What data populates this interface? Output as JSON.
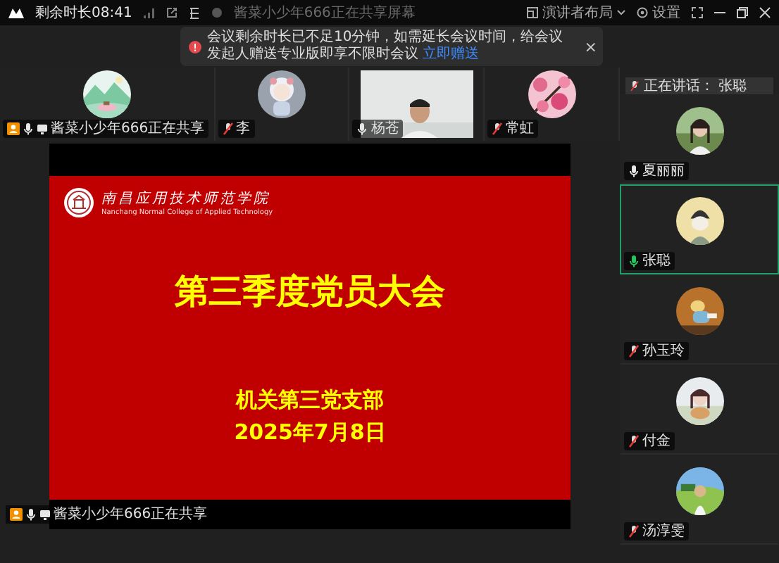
{
  "top_bar": {
    "remaining_time": "剩余时长08:41",
    "sharing_notice": "酱菜小少年666正在共享屏幕",
    "buttons": [
      {
        "kind": "layout",
        "label": "演讲者布局"
      },
      {
        "kind": "settings",
        "label": "设置"
      }
    ]
  },
  "notification": {
    "message": "会议剩余时长已不足10分钟，如需延长会议时间，给会议发起人赠送专业版即享不限时会议",
    "link": "立即赠送",
    "close": "×"
  },
  "top_strip": [
    {
      "name": "酱菜小少年666正在共享",
      "muted": false,
      "host": true,
      "sharing": true,
      "kind": "avatar"
    },
    {
      "name": "李",
      "muted": true,
      "host": false,
      "sharing": false,
      "kind": "avatar"
    },
    {
      "name": "杨苍",
      "muted": false,
      "host": false,
      "sharing": false,
      "kind": "video"
    },
    {
      "name": "常虹",
      "muted": true,
      "host": false,
      "sharing": false,
      "kind": "avatar"
    }
  ],
  "speaking": {
    "label": "正在讲话：",
    "name": "张聪"
  },
  "side_list": [
    {
      "name": "夏丽丽",
      "muted": false,
      "speaking": false,
      "selected": false
    },
    {
      "name": "张聪",
      "muted": false,
      "speaking": true,
      "selected": true
    },
    {
      "name": "孙玉玲",
      "muted": true,
      "speaking": false,
      "selected": false
    },
    {
      "name": "付金",
      "muted": true,
      "speaking": false,
      "selected": false
    },
    {
      "name": "汤淳雯",
      "muted": true,
      "speaking": false,
      "selected": false
    }
  ],
  "slide": {
    "school_name": "南昌应用技术师范学院",
    "school_name_en": "Nanchang Normal College of Applied Technology",
    "title": "第三季度党员大会",
    "department": "机关第三党支部",
    "date": "2025年7月8日"
  },
  "share_label": {
    "name": "酱菜小少年666正在共享",
    "muted": false,
    "host": true,
    "sharing": true
  }
}
